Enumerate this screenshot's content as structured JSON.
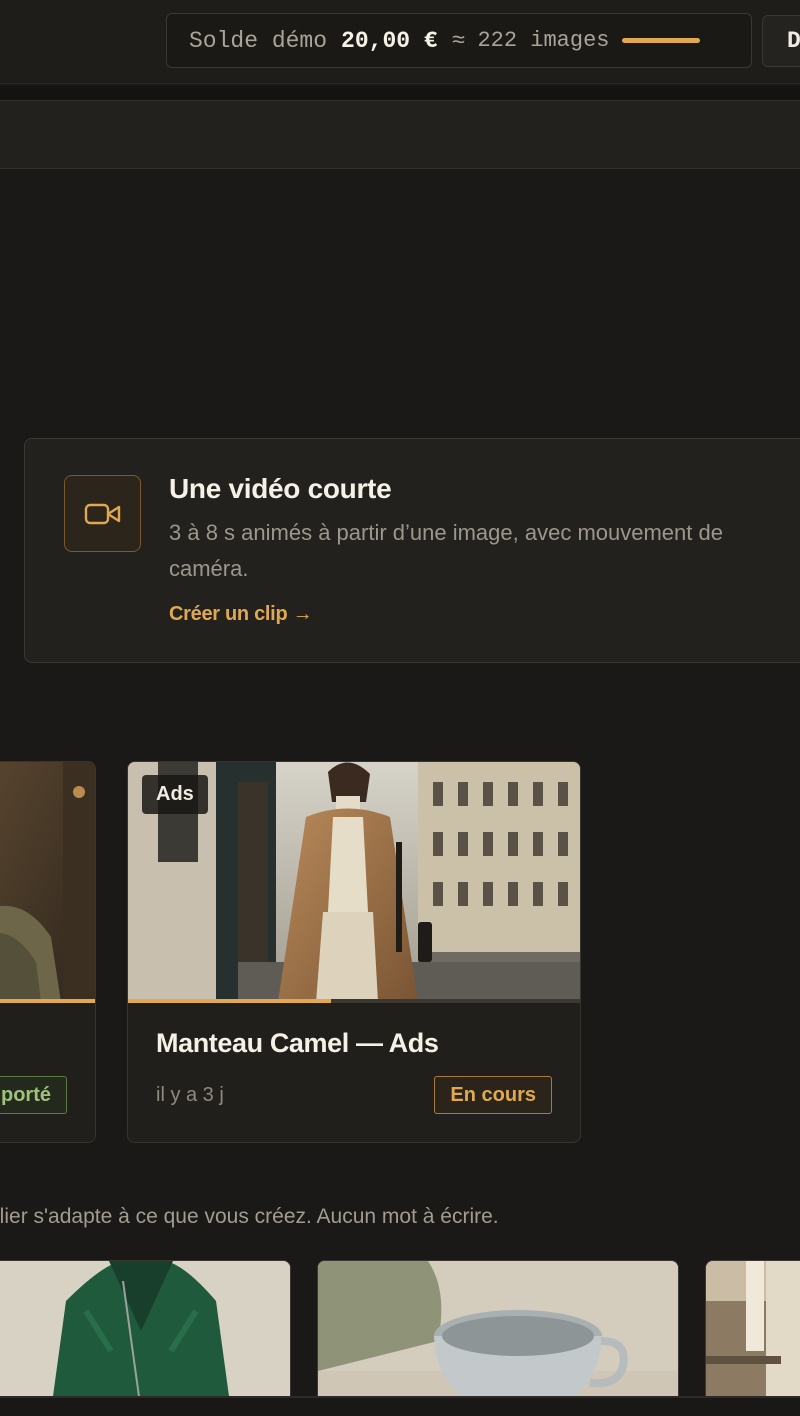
{
  "header": {
    "balance_label": "Solde démo",
    "balance_amount": "20,00 €",
    "approx_symbol": "≈",
    "images_count": "222 images",
    "cut_button_label": "D"
  },
  "video_card": {
    "title": "Une vidéo courte",
    "description": "3 à 8 s animés à partir d’une image, avec mouvement de caméra.",
    "link": "Créer un clip →",
    "icon": "video-camera-icon"
  },
  "projects": [
    {
      "title": "",
      "time": "",
      "status": "porté",
      "progress": 1.0
    },
    {
      "tag": "Ads",
      "title": "Manteau Camel — Ads",
      "time": "il y a 3 j",
      "status": "En cours",
      "progress": 0.45
    }
  ],
  "caption": "elier s'adapte à ce que vous créez. Aucun mot à écrire.",
  "colors": {
    "accent": "#e0a850",
    "success": "#9ec27a",
    "background": "#1a1917",
    "card": "#22211d"
  }
}
